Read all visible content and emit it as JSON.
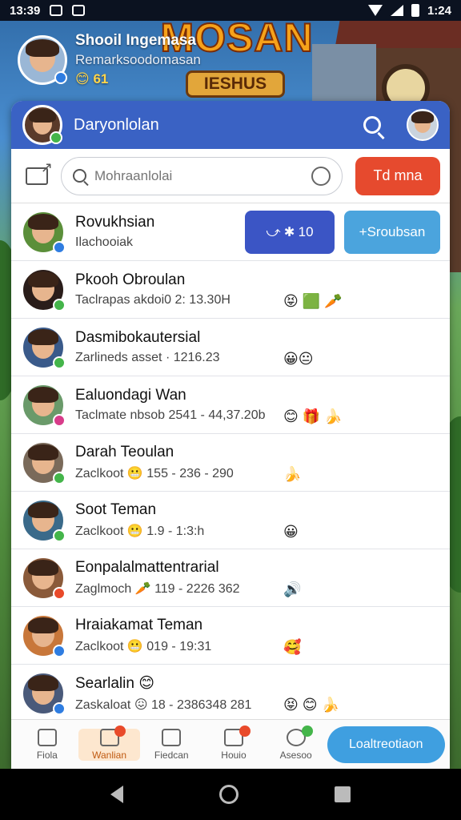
{
  "status_bar": {
    "time_left": "13:39",
    "time_right": "1:24"
  },
  "profile": {
    "name": "Shooil Ingemasa",
    "subtitle": "Remarksoodomasan",
    "coins": "😊 61"
  },
  "logo": {
    "title": "MOSAN",
    "plate": "IESHUS"
  },
  "card": {
    "header_title": "Daryonlolan",
    "search_placeholder": "Mohraanlolai",
    "action_button": "Td mna"
  },
  "contacts": [
    {
      "name": "Rovukhsian",
      "status": "Ilachooiak",
      "avatar_color": "#5b8f3a",
      "badge_color": "#2f7de1",
      "emoji": ""
    },
    {
      "name": "Pkooh Obroulan",
      "status": "Taclrapas akdoi0  2: 13.30H",
      "avatar_color": "#2a1d1a",
      "badge_color": "#44b54a",
      "emoji": "😝 🟩 🥕"
    },
    {
      "name": "Dasmibokautersial",
      "status": "Zarlineds asset · 1216.23",
      "avatar_color": "#3a5a8a",
      "badge_color": "#44b54a",
      "emoji": "😀😐"
    },
    {
      "name": "Ealuondagi Wan",
      "status": "Taclmate nbsob  2541 - 44,37.20b",
      "avatar_color": "#6a9a6a",
      "badge_color": "#d83c8a",
      "emoji": "😊 🎁 🍌"
    },
    {
      "name": "Darah Teoulan",
      "status": "Zaclkoot  😬  155 - 236 - 290",
      "avatar_color": "#7a6a5a",
      "badge_color": "#44b54a",
      "emoji": "🍌"
    },
    {
      "name": "Soot Teman",
      "status": "Zaclkoot  😬  1.9 - 1:3:h",
      "avatar_color": "#3a6a8a",
      "badge_color": "#44b54a",
      "emoji": "😀"
    },
    {
      "name": "Eonpalalmattentrarial",
      "status": "Zaglmoch  🥕  119 - 2226 362",
      "avatar_color": "#8a5a3a",
      "badge_color": "#e94a2a",
      "emoji": "🔊"
    },
    {
      "name": "Hraiakamat Teman",
      "status": "Zaclkoot  😬  019 - 19:31",
      "avatar_color": "#c8773a",
      "badge_color": "#2f7de1",
      "emoji": "🥰"
    },
    {
      "name": "Searlalin 😊",
      "status": "Zaskaloat  😖  18 - 2386348 281",
      "avatar_color": "#4a5a7a",
      "badge_color": "#2f7de1",
      "emoji": "😝 😊 🍌"
    }
  ],
  "row_actions": {
    "blue": "⤻ ✱ 10",
    "light": "+Sroubsan"
  },
  "nav": {
    "items": [
      {
        "label": "Fiola",
        "icon": "home-icon"
      },
      {
        "label": "Wanlian",
        "icon": "chat-icon",
        "badge": "red"
      },
      {
        "label": "Fiedcan",
        "icon": "folder-icon"
      },
      {
        "label": "Houio",
        "icon": "bag-icon",
        "badge": "red"
      },
      {
        "label": "Asesoo",
        "icon": "gear-icon",
        "badge": "green"
      }
    ],
    "cta": "Loaltreotiaon"
  }
}
